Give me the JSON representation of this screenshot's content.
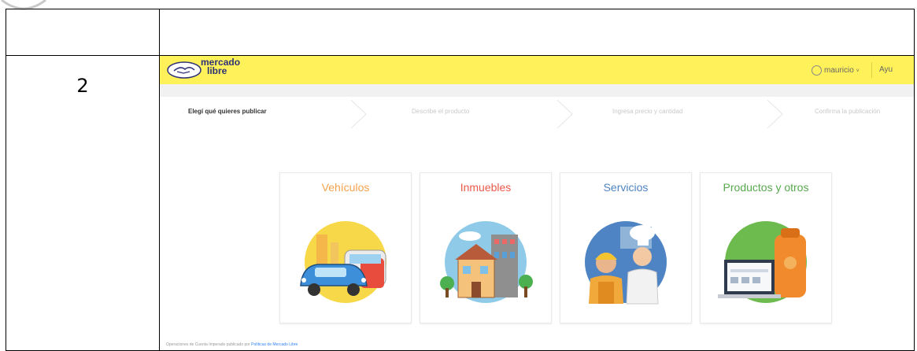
{
  "doc": {
    "row_number": "2"
  },
  "header": {
    "logo_line1": "mercado",
    "logo_line2": "libre",
    "user_label": "mauricio",
    "help_label": "Ayu"
  },
  "steps": [
    {
      "label": "Elegí qué quieres publicar",
      "active": true
    },
    {
      "label": "Describe el producto",
      "active": false
    },
    {
      "label": "Ingresa precio y cantidad",
      "active": false
    },
    {
      "label": "Confirma la publicación",
      "active": false
    }
  ],
  "categories": [
    {
      "label": "Vehículos",
      "color": "#f4a24f"
    },
    {
      "label": "Inmuebles",
      "color": "#ea5a4a"
    },
    {
      "label": "Servicios",
      "color": "#4e84c4"
    },
    {
      "label": "Productos y otros",
      "color": "#58a94e"
    }
  ],
  "footer": {
    "text": "Operaciones de Cuenta Imperado publicado por",
    "link": "Políticas de Mercado Libre"
  }
}
